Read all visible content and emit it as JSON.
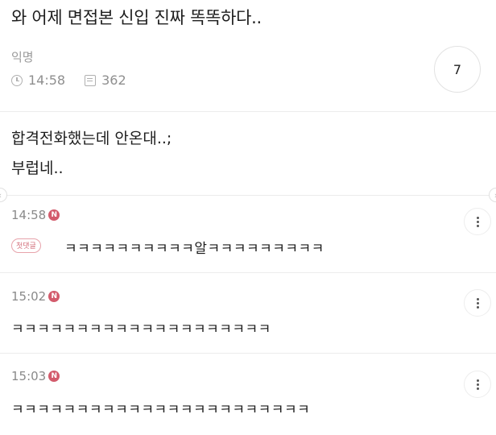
{
  "post": {
    "title": "와 어제 면접본 신입 진짜 똑똑하다..",
    "author": "익명",
    "time": "14:58",
    "views": "362",
    "comment_count": "7",
    "body": [
      "합격전화했는데 안온대..;",
      "부럽네.."
    ]
  },
  "comments": [
    {
      "time": "14:58",
      "new_badge": "N",
      "badge": "첫댓글",
      "text": "ㅋㅋㅋㅋㅋㅋㅋㅋㅋㅋ알ㅋㅋㅋㅋㅋㅋㅋㅋㅋ"
    },
    {
      "time": "15:02",
      "new_badge": "N",
      "text": "ㅋㅋㅋㅋㅋㅋㅋㅋㅋㅋㅋㅋㅋㅋㅋㅋㅋㅋㅋㅋ"
    },
    {
      "time": "15:03",
      "new_badge": "N",
      "text": "ㅋㅋㅋㅋㅋㅋㅋㅋㅋㅋㅋㅋㅋㅋㅋㅋㅋㅋㅋㅋㅋㅋㅋ"
    }
  ],
  "icons": {
    "clock": "clock-icon",
    "views": "view-count-icon",
    "more": "more-vertical-icon",
    "prev": "chevron-left-icon",
    "next": "chevron-right-icon"
  },
  "colors": {
    "new_badge": "#d35b6c",
    "first_comment_badge": "#d3707c"
  }
}
